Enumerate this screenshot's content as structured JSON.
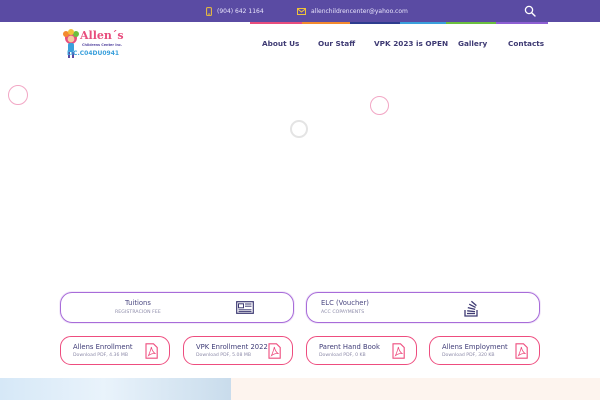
{
  "topbar": {
    "phone": "(904) 642 1164",
    "email": "allenchildrencenter@yahoo.com",
    "search_icon": "search-icon"
  },
  "stripe_colors": [
    "#e84d7d",
    "#f38a2e",
    "#2e3d8f",
    "#3aa0dc",
    "#6bbf3e",
    "#8d5fd3"
  ],
  "logo": {
    "name": "Allen´s",
    "tagline": "Childrens Center Inc.",
    "license": "LIC.C04DU0941"
  },
  "nav": {
    "items": [
      "About Us",
      "Our Staff",
      "VPK 2023 is OPEN",
      "Gallery",
      "Contacts"
    ]
  },
  "cards": [
    {
      "title": "Tuitions",
      "subtitle": "REGISTRACION FEE",
      "icon": "newspaper-icon"
    },
    {
      "title": "ELC (Voucher)",
      "subtitle": "ACC COPAYMENTS",
      "icon": "stack-icon"
    }
  ],
  "downloads": [
    {
      "title": "Allens Enrollment",
      "subtitle": "Download PDF, 4.36 MB"
    },
    {
      "title": "VPK Enrollment 2022",
      "subtitle": "Download PDF, 5.08 MB"
    },
    {
      "title": "Parent Hand Book",
      "subtitle": "Download PDF, 0 KB"
    },
    {
      "title": "Allens Employment",
      "subtitle": "Download PDF, 320 KB"
    }
  ],
  "colors": {
    "topbar": "#5a4ba3",
    "nav_text": "#3e3a73",
    "card_border": "#a86cd9",
    "pill_border": "#ee4d7f",
    "icon_accent": "#f0a93a"
  }
}
